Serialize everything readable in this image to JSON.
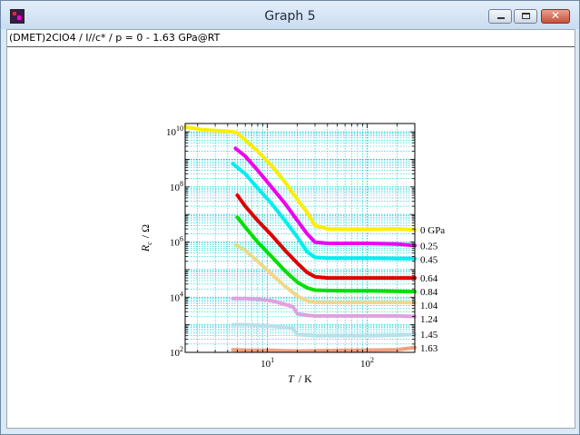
{
  "window": {
    "title": "Graph 5",
    "info_text": "(DMET)2ClO4 / I//c* / p = 0 - 1.63 GPa@RT",
    "close_glyph": "✕"
  },
  "chart_data": {
    "type": "line",
    "x_scale": "log",
    "y_scale": "log",
    "xlim": [
      1.5,
      300
    ],
    "ylim": [
      100,
      20000000000
    ],
    "grid": true,
    "grid_color": "#00c8d8",
    "xlabel": {
      "main": "T",
      "unit": "K"
    },
    "ylabel": {
      "main": "R",
      "sub": "c",
      "unit": "Ω"
    },
    "x_ticks": [
      {
        "value": 10,
        "base": "10",
        "exp": "1"
      },
      {
        "value": 100,
        "base": "10",
        "exp": "2"
      }
    ],
    "y_ticks": [
      {
        "value": 100,
        "base": "10",
        "exp": "2"
      },
      {
        "value": 10000,
        "base": "10",
        "exp": "4"
      },
      {
        "value": 1000000,
        "base": "10",
        "exp": "6"
      },
      {
        "value": 100000000,
        "base": "10",
        "exp": "8"
      },
      {
        "value": 10000000000,
        "base": "10",
        "exp": "10"
      }
    ],
    "series": [
      {
        "name": "0 GPa",
        "color": "#ffee00",
        "x": [
          1.5,
          2.2,
          4.5,
          5.0,
          6.0,
          8.0,
          11.0,
          15.0,
          20.0,
          25.0,
          30.0,
          40.0,
          60.0,
          100.0,
          200.0,
          300.0
        ],
        "y": [
          15000000000,
          12000000000,
          10000000000,
          9000000000,
          5000000000,
          2000000000,
          600000000,
          150000000,
          35000000,
          12000000,
          4000000,
          3000000,
          2900000,
          2900000,
          3000000,
          2800000
        ]
      },
      {
        "name": "0.25",
        "color": "#ee00ee",
        "x": [
          4.8,
          6.0,
          8.0,
          11.0,
          15.0,
          20.0,
          25.0,
          30.0,
          40.0,
          60.0,
          100.0,
          200.0,
          300.0
        ],
        "y": [
          2500000000,
          1300000000,
          400000000,
          100000000,
          25000000,
          6000000,
          2000000,
          1000000,
          900000,
          900000,
          900000,
          850000,
          750000
        ]
      },
      {
        "name": "0.45",
        "color": "#00eeee",
        "x": [
          4.5,
          6.0,
          8.0,
          11.0,
          15.0,
          20.0,
          25.0,
          30.0,
          40.0,
          60.0,
          100.0,
          200.0,
          300.0
        ],
        "y": [
          700000000,
          300000000,
          90000000,
          25000000,
          6000000,
          1500000,
          450000,
          280000,
          260000,
          260000,
          260000,
          255000,
          250000
        ]
      },
      {
        "name": "0.64",
        "color": "#dd0000",
        "x": [
          5.0,
          6.0,
          8.0,
          11.0,
          15.0,
          20.0,
          25.0,
          30.0,
          40.0,
          60.0,
          100.0,
          200.0,
          300.0
        ],
        "y": [
          50000000,
          20000000,
          6000000,
          1800000,
          500000,
          170000,
          80000,
          55000,
          50000,
          50000,
          50000,
          50000,
          50000
        ]
      },
      {
        "name": "0.84",
        "color": "#00e000",
        "x": [
          5.0,
          6.0,
          8.0,
          11.0,
          15.0,
          20.0,
          25.0,
          30.0,
          40.0,
          60.0,
          100.0,
          200.0,
          300.0
        ],
        "y": [
          8000000,
          3500000,
          1000000,
          300000,
          90000,
          35000,
          22000,
          18000,
          17500,
          17000,
          17000,
          16500,
          16000
        ]
      },
      {
        "name": "1.04",
        "color": "#f0d888",
        "x": [
          4.8,
          6.0,
          8.0,
          11.0,
          15.0,
          20.0,
          25.0,
          30.0,
          40.0,
          60.0,
          100.0,
          200.0,
          300.0
        ],
        "y": [
          800000,
          500000,
          200000,
          70000,
          25000,
          11000,
          7500,
          6500,
          6500,
          6500,
          6500,
          6500,
          6300
        ]
      },
      {
        "name": "1.24",
        "color": "#e0a0e0",
        "x": [
          4.5,
          6.0,
          8.0,
          11.0,
          15.0,
          18.0,
          20.0,
          25.0,
          30.0,
          40.0,
          60.0,
          100.0,
          200.0,
          300.0
        ],
        "y": [
          9000,
          9000,
          8500,
          7500,
          5500,
          4500,
          2500,
          2200,
          2100,
          2100,
          2100,
          2100,
          2100,
          2000
        ]
      },
      {
        "name": "1.45",
        "color": "#b8e0ea",
        "x": [
          4.5,
          6.0,
          8.0,
          11.0,
          15.0,
          18.0,
          20.0,
          25.0,
          30.0,
          40.0,
          60.0,
          100.0,
          200.0,
          300.0
        ],
        "y": [
          1000,
          1000,
          950,
          900,
          800,
          750,
          450,
          420,
          400,
          400,
          400,
          400,
          420,
          450
        ]
      },
      {
        "name": "1.63",
        "color": "#f0a080",
        "x": [
          4.5,
          6.0,
          8.0,
          11.0,
          15.0,
          20.0,
          30.0,
          60.0,
          100.0,
          200.0,
          300.0
        ],
        "y": [
          125,
          120,
          118,
          118,
          115,
          112,
          115,
          118,
          120,
          125,
          150
        ]
      }
    ]
  }
}
